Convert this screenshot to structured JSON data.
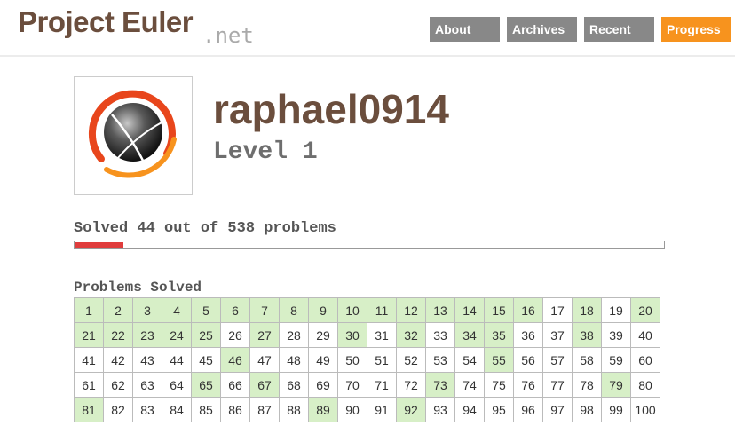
{
  "header": {
    "logo_main": "Project Euler",
    "logo_net": ".net",
    "nav": [
      {
        "label": "About",
        "active": false
      },
      {
        "label": "Archives",
        "active": false
      },
      {
        "label": "Recent",
        "active": false
      },
      {
        "label": "Progress",
        "active": true
      }
    ]
  },
  "profile": {
    "username": "raphael0914",
    "level": "Level 1",
    "avatar_icon": "euler-sphere-avatar-icon"
  },
  "progress": {
    "text": "Solved 44 out of 538 problems",
    "solved": 44,
    "total": 538,
    "bar_color": "#e03c3c"
  },
  "grid": {
    "title": "Problems Solved",
    "problems": [
      1,
      2,
      3,
      4,
      5,
      6,
      7,
      8,
      9,
      10,
      11,
      12,
      13,
      14,
      15,
      16,
      17,
      18,
      19,
      20,
      21,
      22,
      23,
      24,
      25,
      26,
      27,
      28,
      29,
      30,
      31,
      32,
      33,
      34,
      35,
      36,
      37,
      38,
      39,
      40,
      41,
      42,
      43,
      44,
      45,
      46,
      47,
      48,
      49,
      50,
      51,
      52,
      53,
      54,
      55,
      56,
      57,
      58,
      59,
      60,
      61,
      62,
      63,
      64,
      65,
      66,
      67,
      68,
      69,
      70,
      71,
      72,
      73,
      74,
      75,
      76,
      77,
      78,
      79,
      80,
      81,
      82,
      83,
      84,
      85,
      86,
      87,
      88,
      89,
      90,
      91,
      92,
      93,
      94,
      95,
      96,
      97,
      98,
      99,
      100
    ],
    "solved": [
      1,
      2,
      3,
      4,
      5,
      6,
      7,
      8,
      9,
      10,
      11,
      12,
      13,
      14,
      15,
      16,
      18,
      20,
      21,
      22,
      23,
      24,
      25,
      27,
      30,
      32,
      34,
      35,
      38,
      46,
      55,
      65,
      67,
      73,
      79,
      81,
      89,
      92
    ],
    "solved_color": "#d7efc7"
  },
  "colors": {
    "brand_brown": "#6b4e3d",
    "nav_gray": "#888888",
    "nav_active": "#f7931e"
  }
}
